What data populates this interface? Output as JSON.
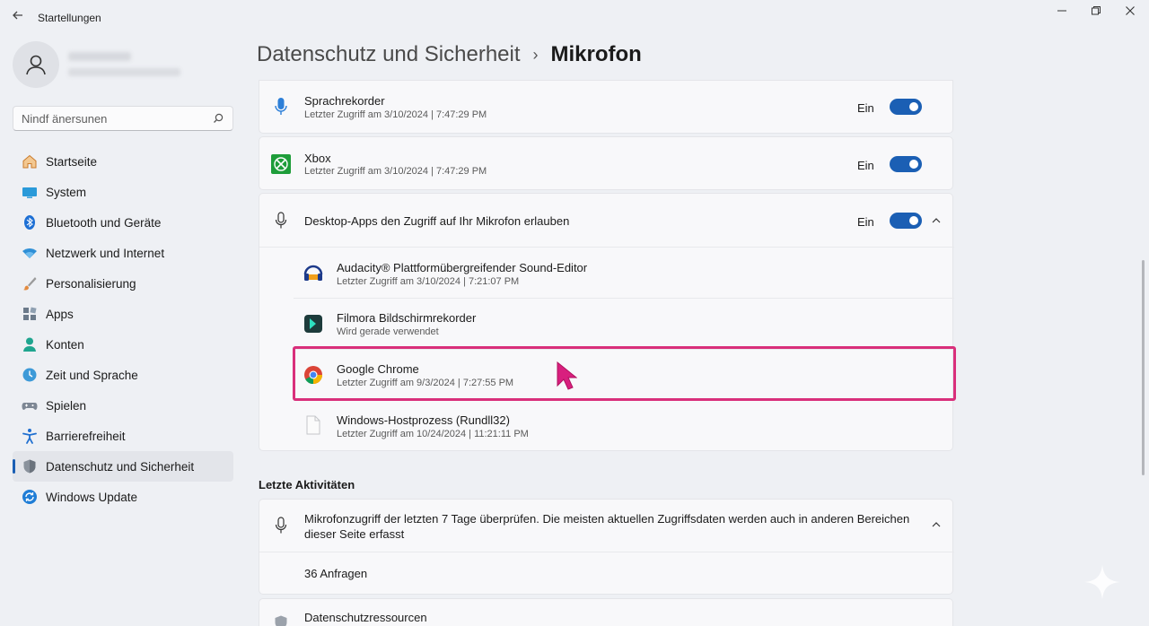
{
  "window": {
    "title": "Startellungen",
    "back_icon": "arrow-left-icon",
    "minimize_icon": "minimize-icon",
    "restore_icon": "restore-icon",
    "close_icon": "close-icon"
  },
  "sidebar": {
    "search_placeholder": "Nindf änersunen",
    "items": [
      {
        "label": "Startseite",
        "icon": "home-icon"
      },
      {
        "label": "System",
        "icon": "monitor-icon"
      },
      {
        "label": "Bluetooth und Geräte",
        "icon": "bluetooth-icon"
      },
      {
        "label": "Netzwerk und Internet",
        "icon": "wifi-icon"
      },
      {
        "label": "Personalisierung",
        "icon": "brush-icon"
      },
      {
        "label": "Apps",
        "icon": "apps-icon"
      },
      {
        "label": "Konten",
        "icon": "person-icon"
      },
      {
        "label": "Zeit und Sprache",
        "icon": "clock-globe-icon"
      },
      {
        "label": "Spielen",
        "icon": "gamepad-icon"
      },
      {
        "label": "Barrierefreiheit",
        "icon": "accessibility-icon"
      },
      {
        "label": "Datenschutz und Sicherheit",
        "icon": "shield-icon",
        "active": true
      },
      {
        "label": "Windows Update",
        "icon": "update-icon"
      }
    ]
  },
  "breadcrumb": {
    "parent": "Datenschutz und Sicherheit",
    "separator": "›",
    "current": "Mikrofon"
  },
  "apps": [
    {
      "name": "Sprachrekorder",
      "detail": "Letzter Zugriff am 3/10/2024 | 7:47:29 PM",
      "state": "Ein",
      "icon": "microphone-app-icon"
    },
    {
      "name": "Xbox",
      "detail": "Letzter Zugriff am 3/10/2024 | 7:47:29 PM",
      "state": "Ein",
      "icon": "xbox-icon"
    }
  ],
  "desktop_apps": {
    "title": "Desktop-Apps den Zugriff auf Ihr Mikrofon erlauben",
    "state": "Ein",
    "items": [
      {
        "name": "Audacity® Plattformübergreifender Sound-Editor",
        "detail": "Letzter Zugriff am 3/10/2024 | 7:21:07 PM",
        "icon": "audacity-icon"
      },
      {
        "name": "Filmora Bildschirmrekorder",
        "detail": "Wird gerade verwendet",
        "icon": "filmora-icon"
      },
      {
        "name": "Google Chrome",
        "detail": "Letzter Zugriff am 9/3/2024 | 7:27:55 PM",
        "icon": "chrome-icon"
      },
      {
        "name": "Windows-Hostprozess (Rundll32)",
        "detail": "Letzter Zugriff am 10/24/2024 | 11:21:11 PM",
        "icon": "file-icon"
      }
    ]
  },
  "recent": {
    "section_title": "Letzte Aktivitäten",
    "title": "Mikrofonzugriff der letzten 7 Tage überprüfen. Die meisten aktuellen Zugriffsdaten werden auch in anderen Bereichen dieser Seite erfasst",
    "count": "36 Anfragen"
  },
  "resources": {
    "title": "Datenschutzressourcen"
  },
  "colors": {
    "accent": "#1b5fb4",
    "highlight": "#d92f7b",
    "background": "#eef0f4"
  }
}
